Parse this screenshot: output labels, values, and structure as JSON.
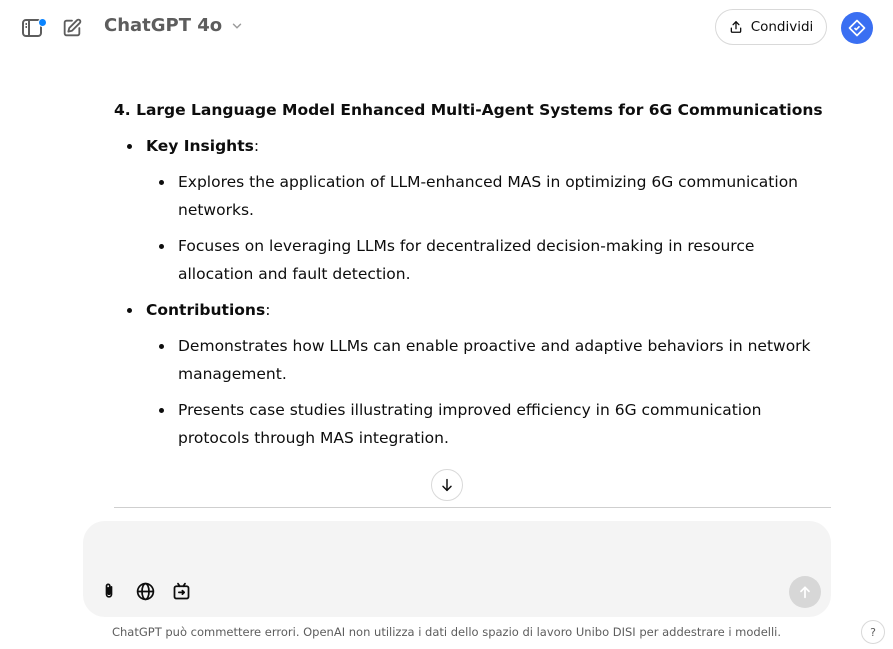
{
  "topbar": {
    "model_title": "ChatGPT 4o",
    "share_label": "Condividi"
  },
  "message": {
    "heading": "4. Large Language Model Enhanced Multi-Agent Systems for 6G Communications",
    "sections": [
      {
        "label": "Key Insights",
        "suffix": ":",
        "items": [
          "Explores the application of LLM-enhanced MAS in optimizing 6G communication networks.",
          "Focuses on leveraging LLMs for decentralized decision-making in resource allocation and fault detection."
        ]
      },
      {
        "label": "Contributions",
        "suffix": ":",
        "items": [
          "Demonstrates how LLMs can enable proactive and adaptive behaviors in network management.",
          "Presents case studies illustrating improved efficiency in 6G communication protocols through MAS integration."
        ]
      }
    ]
  },
  "composer": {
    "placeholder": ""
  },
  "footer": {
    "note": "ChatGPT può commettere errori. OpenAI non utilizza i dati dello spazio di lavoro Unibo DISI per addestrare i modelli.",
    "help_label": "?"
  },
  "colors": {
    "accent": "#3a6ff2",
    "notification_dot": "#0a84ff"
  },
  "icons": [
    "sidebar-toggle-icon",
    "new-chat-icon",
    "chevron-down-icon",
    "share-icon",
    "avatar-icon",
    "arrow-down-icon",
    "paperclip-icon",
    "globe-icon",
    "tools-icon",
    "arrow-up-icon"
  ]
}
